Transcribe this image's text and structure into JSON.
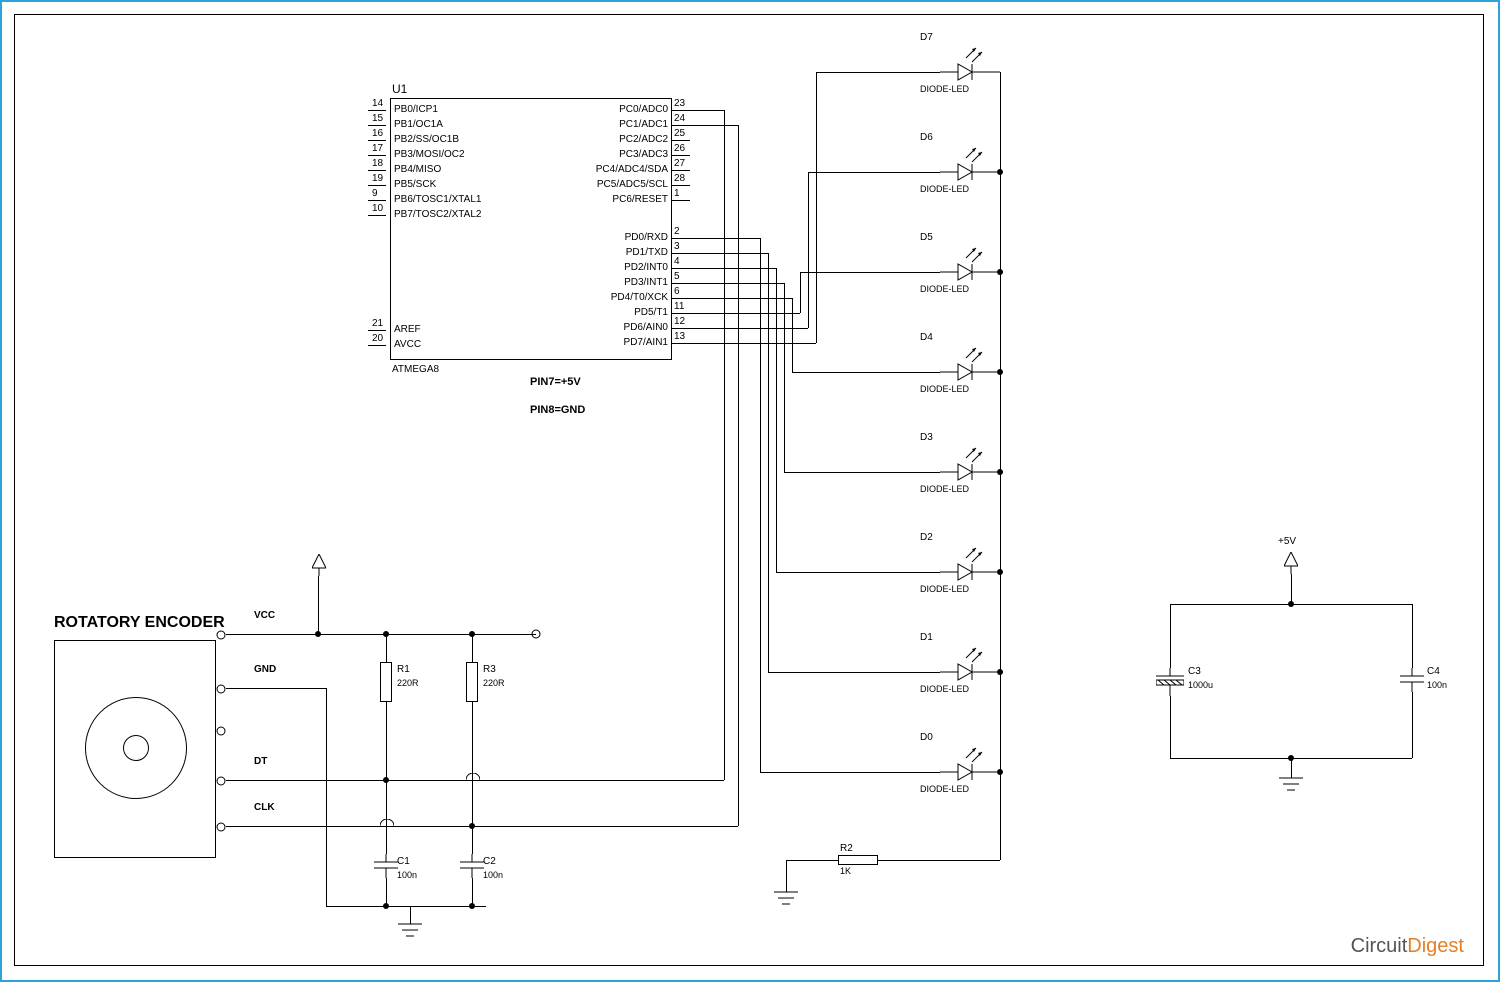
{
  "title": "ROTATORY ENCODER",
  "ic": {
    "ref": "U1",
    "part": "ATMEGA8",
    "note1": "PIN7=+5V",
    "note2": "PIN8=GND",
    "left_pins": [
      {
        "num": "14",
        "label": "PB0/ICP1"
      },
      {
        "num": "15",
        "label": "PB1/OC1A"
      },
      {
        "num": "16",
        "label": "PB2/SS/OC1B"
      },
      {
        "num": "17",
        "label": "PB3/MOSI/OC2"
      },
      {
        "num": "18",
        "label": "PB4/MISO"
      },
      {
        "num": "19",
        "label": "PB5/SCK"
      },
      {
        "num": "9",
        "label": "PB6/TOSC1/XTAL1"
      },
      {
        "num": "10",
        "label": "PB7/TOSC2/XTAL2"
      }
    ],
    "left_pins_bot": [
      {
        "num": "21",
        "label": "AREF"
      },
      {
        "num": "20",
        "label": "AVCC"
      }
    ],
    "right_pins": [
      {
        "num": "23",
        "label": "PC0/ADC0"
      },
      {
        "num": "24",
        "label": "PC1/ADC1"
      },
      {
        "num": "25",
        "label": "PC2/ADC2"
      },
      {
        "num": "26",
        "label": "PC3/ADC3"
      },
      {
        "num": "27",
        "label": "PC4/ADC4/SDA"
      },
      {
        "num": "28",
        "label": "PC5/ADC5/SCL"
      },
      {
        "num": "1",
        "label": "PC6/RESET"
      }
    ],
    "right_pins2": [
      {
        "num": "2",
        "label": "PD0/RXD"
      },
      {
        "num": "3",
        "label": "PD1/TXD"
      },
      {
        "num": "4",
        "label": "PD2/INT0"
      },
      {
        "num": "5",
        "label": "PD3/INT1"
      },
      {
        "num": "6",
        "label": "PD4/T0/XCK"
      },
      {
        "num": "11",
        "label": "PD5/T1"
      },
      {
        "num": "12",
        "label": "PD6/AIN0"
      },
      {
        "num": "13",
        "label": "PD7/AIN1"
      }
    ]
  },
  "leds": [
    {
      "ref": "D7",
      "type": "DIODE-LED"
    },
    {
      "ref": "D6",
      "type": "DIODE-LED"
    },
    {
      "ref": "D5",
      "type": "DIODE-LED"
    },
    {
      "ref": "D4",
      "type": "DIODE-LED"
    },
    {
      "ref": "D3",
      "type": "DIODE-LED"
    },
    {
      "ref": "D2",
      "type": "DIODE-LED"
    },
    {
      "ref": "D1",
      "type": "DIODE-LED"
    },
    {
      "ref": "D0",
      "type": "DIODE-LED"
    }
  ],
  "resistors": [
    {
      "ref": "R1",
      "value": "220R"
    },
    {
      "ref": "R3",
      "value": "220R"
    },
    {
      "ref": "R2",
      "value": "1K"
    }
  ],
  "caps": [
    {
      "ref": "C1",
      "value": "100n"
    },
    {
      "ref": "C2",
      "value": "100n"
    },
    {
      "ref": "C3",
      "value": "1000u"
    },
    {
      "ref": "C4",
      "value": "100n"
    }
  ],
  "encoder_pins": [
    "VCC",
    "GND",
    "DT",
    "CLK"
  ],
  "misc": {
    "open_terminal": "",
    "plus5v": "+5V"
  },
  "logo": {
    "a": "Circuit",
    "b": "Digest"
  }
}
